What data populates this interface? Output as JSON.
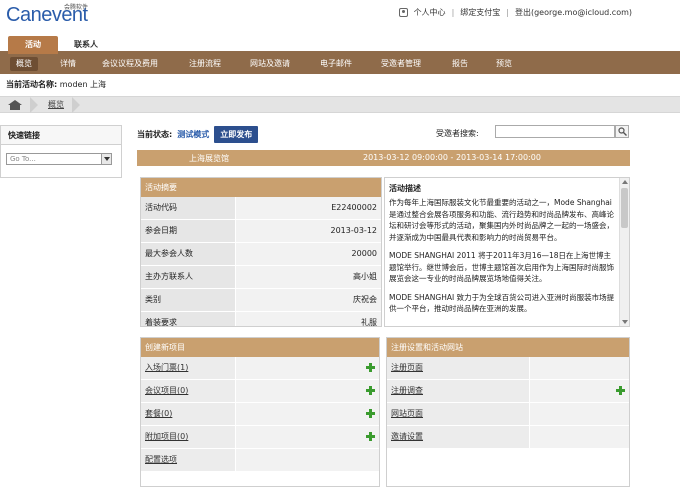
{
  "header": {
    "logo_main": "Canevent",
    "logo_sub": "会腾软件",
    "links": [
      "个人中心",
      "绑定支付宝",
      "登出(george.mo@icloud.com)"
    ]
  },
  "main_tabs": [
    {
      "label": "活动",
      "active": true
    },
    {
      "label": "联系人",
      "active": false
    }
  ],
  "sub_nav": [
    "概览",
    "详情",
    "会议议程及费用",
    "注册流程",
    "网站及邀请",
    "电子邮件",
    "受邀者管理",
    "报告",
    "预览"
  ],
  "current_activity": {
    "label": "当前活动名称:",
    "value": "moden 上海"
  },
  "breadcrumb": {
    "current": "概览"
  },
  "quick_links": {
    "title": "快速链接",
    "select_value": "Go To..."
  },
  "status": {
    "label": "当前状态:",
    "mode": "测试模式",
    "publish_button": "立即发布"
  },
  "search": {
    "label": "受邀者搜索:",
    "placeholder": ""
  },
  "venue": {
    "name": "上海展览馆",
    "time": "2013-03-12 09:00:00 - 2013-03-14 17:00:00"
  },
  "summary": {
    "title": "活动摘要",
    "rows": [
      {
        "k": "活动代码",
        "v": "E22400002"
      },
      {
        "k": "参会日期",
        "v": "2013-03-12"
      },
      {
        "k": "最大参会人数",
        "v": "20000"
      },
      {
        "k": "主办方联系人",
        "v": "高小姐"
      },
      {
        "k": "类别",
        "v": "庆祝会"
      },
      {
        "k": "着装要求",
        "v": "礼服"
      }
    ]
  },
  "description": {
    "title": "活动描述",
    "paragraphs": [
      "作为每年上海国际服装文化节最重要的活动之一，Mode Shanghai是通过整合会展各项服务和功能、流行趋势和时尚品牌发布、高峰论坛和研讨会等形式的活动，聚集国内外时尚品牌之一起的一场盛会，并逐渐成为中国最具代表和影响力的时尚贸易平台。",
      "MODE SHANGHAI 2011 将于2011年3月16—18日在上海世博主题馆举行。继世博会后，世博主题馆首次启用作为上海国际时尚服饰展览会这一专业的时尚品牌展览场地值得关注。",
      "MODE SHANGHAI 致力于为全球百货公司进入亚洲时尚服装市场提供一个平台，推动时尚品牌在亚洲的发展。"
    ]
  },
  "create": {
    "title": "创建新项目",
    "items": [
      "入场门票(1)",
      "会议项目(0)",
      "套餐(0)",
      "附加项目(0)",
      "配置选项"
    ]
  },
  "registration": {
    "title": "注册设置和活动网站",
    "items": [
      "注册页面",
      "注册调查",
      "网站页面",
      "邀请设置"
    ]
  },
  "colors": {
    "accent": "#c9a06f",
    "nav": "#8f6b4a",
    "link": "#2a5caa",
    "publish": "#2c4f8e",
    "plus": "#3a9b2e"
  }
}
